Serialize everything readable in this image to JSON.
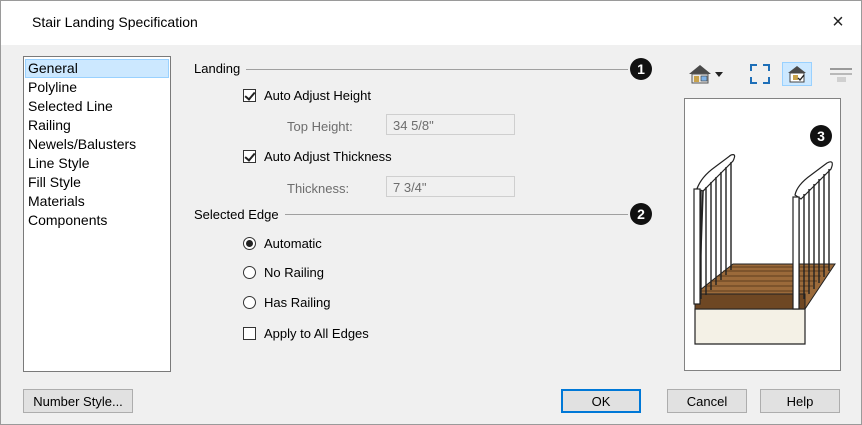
{
  "dialog": {
    "title": "Stair Landing Specification",
    "close_glyph": "×"
  },
  "nav": {
    "items": [
      {
        "label": "General",
        "selected": true
      },
      {
        "label": "Polyline"
      },
      {
        "label": "Selected Line"
      },
      {
        "label": "Railing"
      },
      {
        "label": "Newels/Balusters"
      },
      {
        "label": "Line Style"
      },
      {
        "label": "Fill Style"
      },
      {
        "label": "Materials"
      },
      {
        "label": "Components"
      }
    ]
  },
  "landing": {
    "group_label": "Landing",
    "callout": "1",
    "auto_adjust_height": {
      "label": "Auto Adjust Height",
      "checked": true
    },
    "top_height": {
      "label": "Top Height:",
      "value": "34 5/8\""
    },
    "auto_adjust_thickness": {
      "label": "Auto Adjust Thickness",
      "checked": true
    },
    "thickness": {
      "label": "Thickness:",
      "value": "7 3/4\""
    }
  },
  "selected_edge": {
    "group_label": "Selected Edge",
    "callout": "2",
    "options": [
      {
        "label": "Automatic",
        "checked": true
      },
      {
        "label": "No Railing",
        "checked": false
      },
      {
        "label": "Has Railing",
        "checked": false
      }
    ],
    "apply_all": {
      "label": "Apply to All Edges",
      "checked": false
    }
  },
  "preview": {
    "callout": "3",
    "toolbar": [
      "view-camera-icon",
      "dropdown-arrow-icon",
      "fit-view-icon",
      "show-object-icon",
      "toggle-rail-icon"
    ]
  },
  "buttons": {
    "number_style": "Number Style...",
    "ok": "OK",
    "cancel": "Cancel",
    "help": "Help"
  },
  "colors": {
    "dialog_bg": "#f0f0f0",
    "selection_bg": "#cce8ff",
    "accent": "#0078d7",
    "callout_bg": "#111111"
  }
}
